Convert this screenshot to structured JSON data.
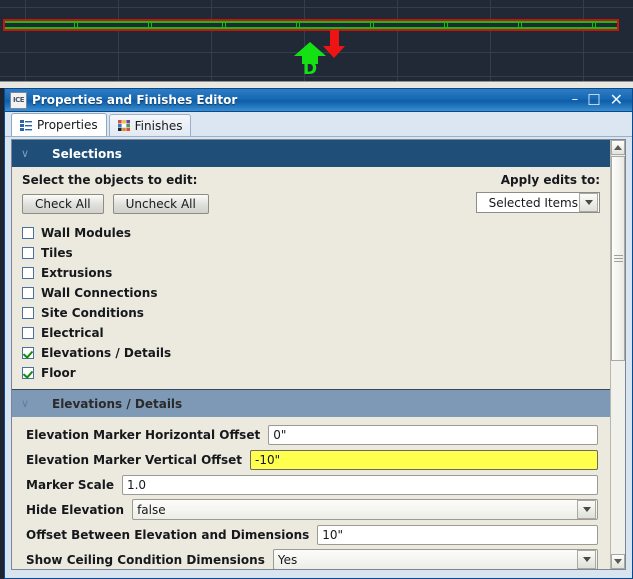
{
  "cad": {
    "background_color": "#212836",
    "grid_color": "#333d52",
    "wall": {
      "outline_color": "#cc1111",
      "line_color": "#12c012"
    },
    "elevation_marker": {
      "label": "D",
      "color": "#14e014",
      "direction": "up"
    },
    "dimension_marker": {
      "color": "#ee1414",
      "direction": "down"
    }
  },
  "window": {
    "title": "Properties and Finishes Editor",
    "app_icon_label": "ICE",
    "minimize_label": "–",
    "maximize_label": "☐",
    "close_label": "✕",
    "titlebar_color": "#1668b4"
  },
  "tabs": [
    {
      "label": "Properties",
      "icon": "list-icon",
      "active": true
    },
    {
      "label": "Finishes",
      "icon": "color-swatch-icon",
      "active": false
    }
  ],
  "selections": {
    "header": "Selections",
    "chevron": "∨",
    "prompt": "Select the objects to edit:",
    "check_all_label": "Check All",
    "uncheck_all_label": "Uncheck All",
    "apply_label": "Apply edits to:",
    "apply_value": "Selected Items",
    "items": [
      {
        "label": "Wall Modules",
        "checked": false
      },
      {
        "label": "Tiles",
        "checked": false
      },
      {
        "label": "Extrusions",
        "checked": false
      },
      {
        "label": "Wall Connections",
        "checked": false
      },
      {
        "label": "Site Conditions",
        "checked": false
      },
      {
        "label": "Electrical",
        "checked": false
      },
      {
        "label": "Elevations / Details",
        "checked": true
      },
      {
        "label": "Floor",
        "checked": true
      }
    ]
  },
  "elevations": {
    "header": "Elevations / Details",
    "chevron": "∨",
    "header_color": "#7e99b5",
    "fields": [
      {
        "label": "Elevation Marker Horizontal Offset",
        "value": "0\"",
        "type": "text",
        "highlighted": false
      },
      {
        "label": "Elevation Marker Vertical Offset",
        "value": "-10\"",
        "type": "text",
        "highlighted": true
      },
      {
        "label": "Marker Scale",
        "value": "1.0",
        "type": "text",
        "highlighted": false
      },
      {
        "label": "Hide Elevation",
        "value": "false",
        "type": "combo",
        "highlighted": false
      },
      {
        "label": "Offset Between Elevation and Dimensions",
        "value": "10\"",
        "type": "text",
        "highlighted": false
      },
      {
        "label": "Show Ceiling Condition Dimensions",
        "value": "Yes",
        "type": "combo",
        "highlighted": false
      }
    ]
  },
  "scrollbar": {
    "up_label": "▲",
    "down_label": "▼"
  }
}
